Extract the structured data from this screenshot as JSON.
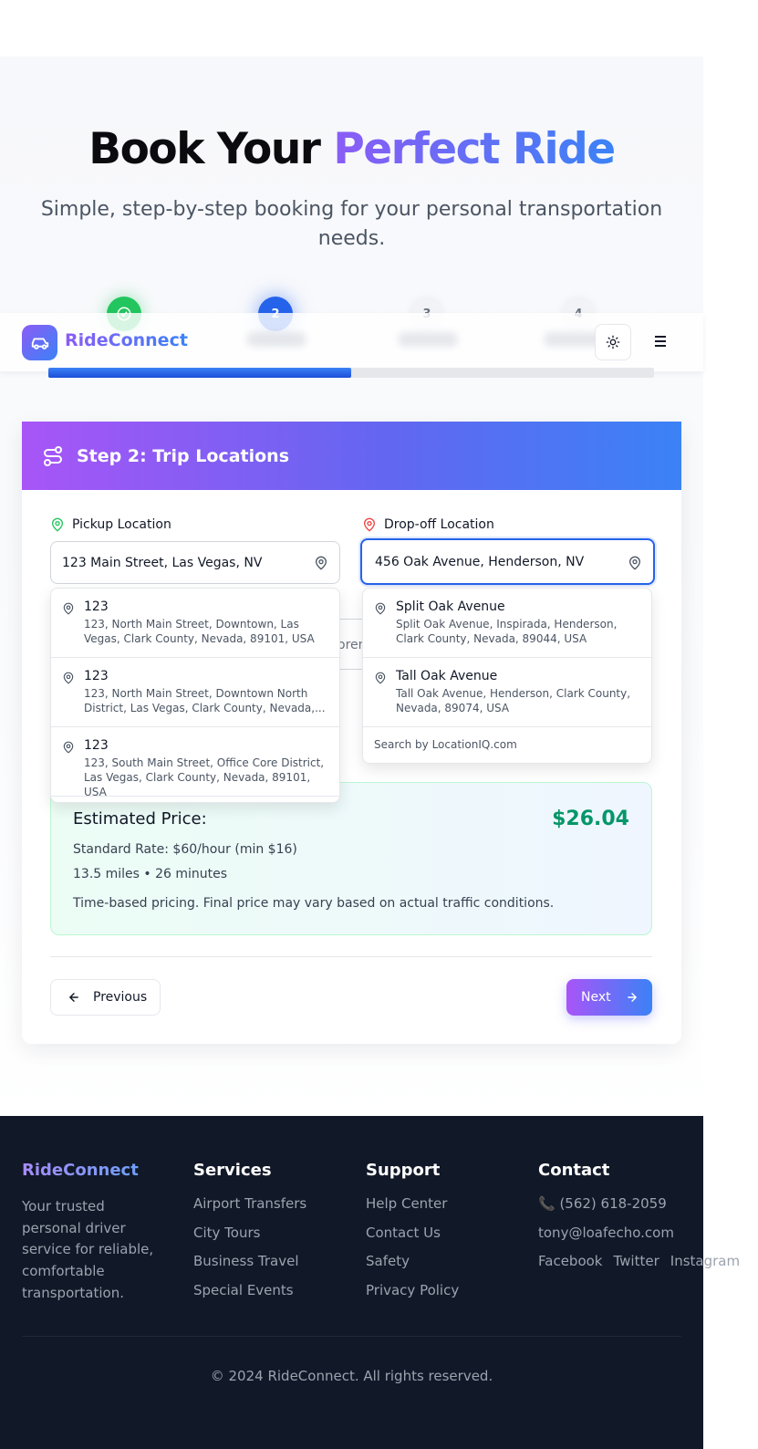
{
  "hero": {
    "title_plain": "Book Your",
    "title_accent": "Perfect Ride",
    "subtitle": "Simple, step-by-step booking for your personal transportation needs."
  },
  "stepper": {
    "steps": [
      "",
      "2",
      "3",
      "4"
    ],
    "current": 2,
    "progress_fraction": 0.5
  },
  "header": {
    "brand": "RideConnect",
    "theme_icon": "sun-icon",
    "menu_icon": "hamburger-icon"
  },
  "card": {
    "title": "Step 2: Trip Locations",
    "pickup": {
      "label": "Pickup Location",
      "value": "123 Main Street, Las Vegas, NV",
      "suggestions": [
        {
          "main": "123",
          "sub": "123, North Main Street, Downtown, Las Vegas, Clark County, Nevada, 89101, USA"
        },
        {
          "main": "123",
          "sub": "123, North Main Street, Downtown North District, Las Vegas, Clark County, Nevada,..."
        },
        {
          "main": "123",
          "sub": "123, South Main Street, Office Core District, Las Vegas, Clark County, Nevada, 89101, USA"
        }
      ]
    },
    "dropoff": {
      "label": "Drop-off Location",
      "value": "456 Oak Avenue, Henderson, NV",
      "suggestions": [
        {
          "main": "Split Oak Avenue",
          "sub": "Split Oak Avenue, Inspirada, Henderson, Clark County, Nevada, 89044, USA"
        },
        {
          "main": "Tall Oak Avenue",
          "sub": "Tall Oak Avenue, Henderson, Clark County, Nevada, 89074, USA"
        }
      ],
      "footer": "Search by LocationIQ.com"
    },
    "hidden_field_fragment": "oren",
    "estimate": {
      "label": "Estimated Price:",
      "value": "$26.04",
      "rate": "Standard Rate: $60/hour (min $16)",
      "trip": "13.5 miles • 26 minutes",
      "note": "Time-based pricing. Final price may vary based on actual traffic conditions."
    },
    "prev_label": "Previous",
    "next_label": "Next"
  },
  "footer": {
    "brand": "RideConnect",
    "tagline": "Your trusted personal driver service for reliable, comfortable transportation.",
    "services": {
      "heading": "Services",
      "items": [
        "Airport Transfers",
        "City Tours",
        "Business Travel",
        "Special Events"
      ]
    },
    "support": {
      "heading": "Support",
      "items": [
        "Help Center",
        "Contact Us",
        "Safety",
        "Privacy Policy"
      ]
    },
    "contact": {
      "heading": "Contact",
      "phone": "📞 (562) 618-2059",
      "email": "tony@loafecho.com",
      "socials": [
        "Facebook",
        "Twitter",
        "Instagram"
      ]
    },
    "copyright": "© 2024 RideConnect. All rights reserved."
  },
  "colors": {
    "accent_purple": "#8b5cf6",
    "accent_blue": "#3b82f6",
    "step_done": "#22c55e",
    "step_active": "#2563eb",
    "price": "#059669",
    "footer_bg": "#111827"
  }
}
